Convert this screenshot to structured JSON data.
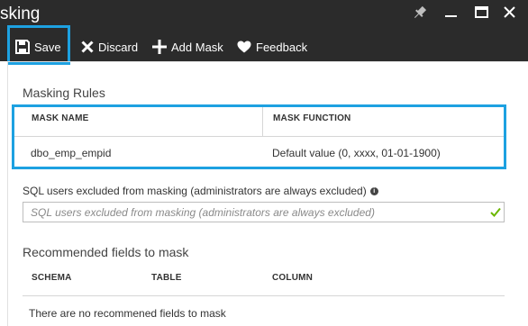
{
  "window": {
    "title": "sking",
    "controls": [
      "pin-icon",
      "minimize-icon",
      "maximize-icon",
      "close-icon"
    ]
  },
  "toolbar": {
    "save_label": "Save",
    "discard_label": "Discard",
    "add_mask_label": "Add Mask",
    "feedback_label": "Feedback"
  },
  "masking_rules": {
    "title": "Masking Rules",
    "columns": [
      "MASK NAME",
      "MASK FUNCTION"
    ],
    "rows": [
      {
        "mask_name": "dbo_emp_empid",
        "mask_function": "Default value (0, xxxx, 01-01-1900)"
      }
    ]
  },
  "excluded_users": {
    "label": "SQL users excluded from masking (administrators are always excluded)",
    "info_icon": "i",
    "placeholder": "SQL users excluded from masking (administrators are always excluded)",
    "value": ""
  },
  "recommended": {
    "title": "Recommended fields to mask",
    "columns": [
      "SCHEMA",
      "TABLE",
      "COLUMN"
    ],
    "empty_message": "There are no recommened fields to mask"
  },
  "colors": {
    "header_bg": "#2b2b2b",
    "highlight": "#1da1e1",
    "valid_check": "#6bb700"
  }
}
